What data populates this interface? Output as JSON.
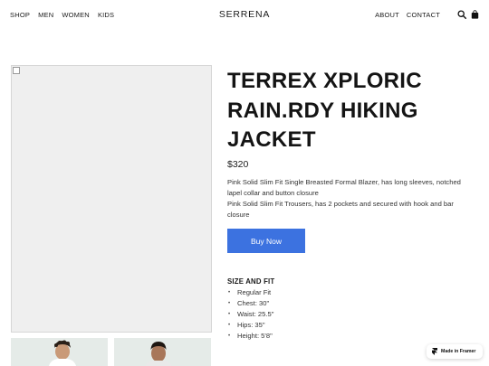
{
  "nav": {
    "left": [
      {
        "label": "SHOP"
      },
      {
        "label": "MEN"
      },
      {
        "label": "WOMEN"
      },
      {
        "label": "KIDS"
      }
    ],
    "brand": "SERRENA",
    "right": [
      {
        "label": "ABOUT"
      },
      {
        "label": "CONTACT"
      }
    ],
    "icons": [
      "search-icon",
      "shopping-bag-icon"
    ]
  },
  "product": {
    "title": "TERREX XPLORIC RAIN.RDY HIKING JACKET",
    "price": "$320",
    "description_lines": [
      "Pink Solid Slim Fit Single Breasted Formal Blazer, has long sleeves, notched lapel collar and button closure",
      "Pink Solid Slim Fit Trousers, has 2 pockets and secured with hook and bar closure"
    ],
    "buy_label": "Buy Now",
    "size_title": "SIZE AND FIT",
    "size_items": [
      "Regular Fit",
      "Chest: 30\"",
      "Waist: 25.5\"",
      "Hips: 35\"",
      "Height: 5'8\""
    ]
  },
  "badge": {
    "label": "Made in Framer"
  },
  "colors": {
    "accent": "#3c72e0",
    "text": "#1a1a1a",
    "image_placeholder": "#efefef"
  }
}
